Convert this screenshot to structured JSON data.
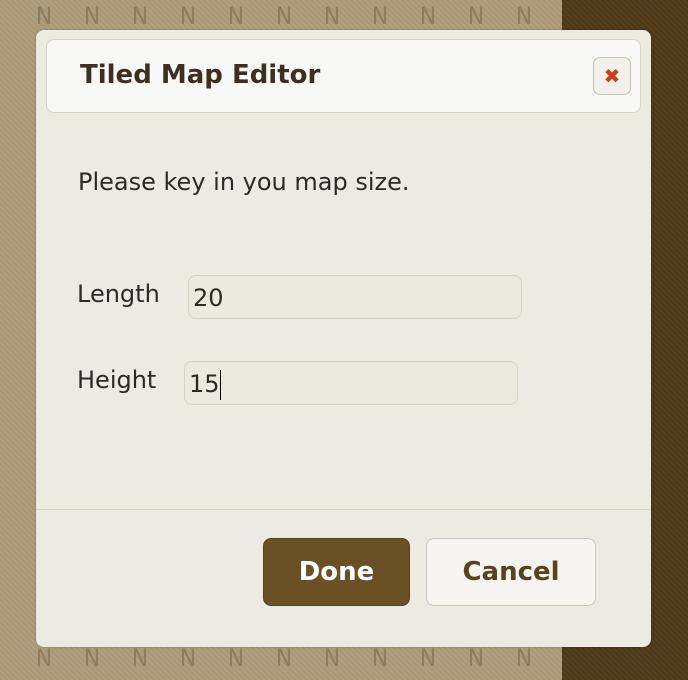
{
  "background": {
    "tile_label": "N",
    "colors": {
      "tan": "#b0a080",
      "dark": "#4a3818"
    }
  },
  "dialog": {
    "title": "Tiled Map Editor",
    "close_icon": "close-x-icon",
    "prompt": "Please key in you map size.",
    "fields": [
      {
        "label": "Length",
        "value": "20"
      },
      {
        "label": "Height",
        "value": "15"
      }
    ],
    "buttons": {
      "done": "Done",
      "cancel": "Cancel"
    },
    "colors": {
      "accent": "#6b5026",
      "close": "#c8401a"
    }
  }
}
